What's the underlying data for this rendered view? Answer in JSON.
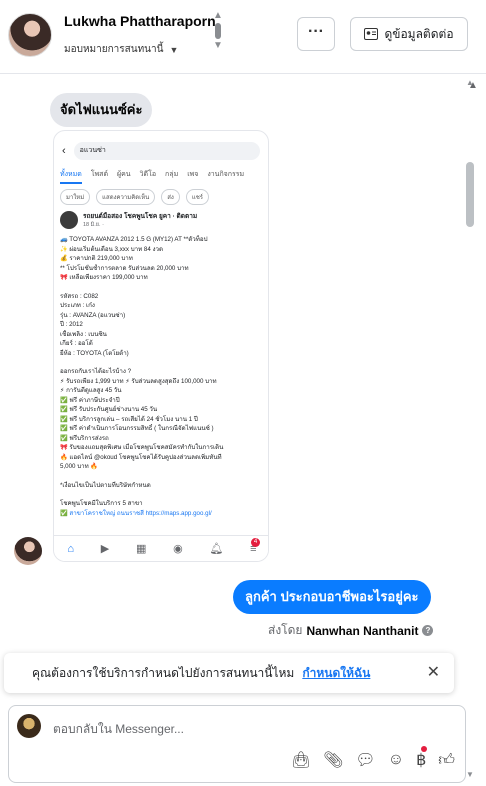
{
  "header": {
    "contact_name": "Lukwha Phattharaporn",
    "assign_label": "มอบหมายการสนทนานี้",
    "more_label": "···",
    "contact_info_label": "ดูข้อมูลติดต่อ"
  },
  "messages": {
    "incoming_text": "จัดไฟแนนซ์ค่ะ",
    "outgoing_text": "ลูกค้า ประกอบอาชีพอะไรอยู่คะ",
    "sent_by_prefix": "ส่งโดย",
    "sent_by_name": "Nanwhan Nanthanit"
  },
  "shared_screenshot": {
    "search_text": "อแวนซ่า",
    "tabs": [
      "ทั้งหมด",
      "โพสต์",
      "ผู้คน",
      "วิดีโอ",
      "กลุ่ม",
      "เพจ",
      "งานกิจกรรม"
    ],
    "chips": [
      "มาใหม่",
      "แสดงความคิดเห็น",
      "ส่ง",
      "แชร์"
    ],
    "post_author": "รถยนต์มือสอง โชคพูนโชค ยูคา · ติดตาม",
    "post_date": "18 มิ.ย. · ",
    "body_lines": [
      "🚙 TOYOTA AVANZA 2012 1.5 G (MY12) AT **ตัวท็อป",
      "✨ ผ่อนเริ่มต้นเดือน 3,xxx บาท 84 งวด",
      "💰 ราคาปกติ 219,000 บาท",
      "** โปรโมชั่นช้ำการตลาด รับส่วนลด 20,000 บาท",
      "🎀 เหลือเพียงราคา 199,000 บาท",
      "",
      "รหัสรถ : C082",
      "ประเภท : เก๋ง",
      "รุ่น : AVANZA (อแวนซ่า)",
      "ปี : 2012",
      "เชื้อเพลิง : เบนซิน",
      "เกียร์ : ออโต้",
      "ยี่ห้อ : TOYOTA (โตโยต้า)",
      "",
      "ออกรถกับเราได้อะไรบ้าง ?",
      "⚡ รับรถเพียง 1,999 บาท ⚡ รับส่วนลดสูงสุดถึง 100,000 บาท",
      "⚡ การันตีดูแลสูง 45 วัน",
      "✅ ฟรี ค่าภาษีประจำปี",
      "✅ ฟรี รับประกันศูนย์ช่างนาน 45 วัน",
      "✅ ฟรี บริการลูกเล่น – รถเสียได้ 24 ชั่วโมง นาน 1 ปี",
      "✅ ฟรี ค่าดำเนินการโอนกรรมสิทธิ์ ( ในกรณีจัดไฟแนนซ์ )",
      "✅ ฟรีบริการส่งรถ",
      "🎀 รับของแถมสุดพิเศษ เมื่อโชคพูนโชคสมัครทำกับในการเดิน",
      "🔥 แอดไลน์ @okoud โชคพูนโชคได้รับคูปองส่วนลดเพิ่มทันที",
      "5,000 บาท 🔥",
      "",
      "*เงื่อนไขเป็นไปตามที่บริษัทกำหนด",
      "",
      "โชคพูนโชคมีในบริการ 5 สาขา",
      "✅ สาขาโคราชใหญ่ ถนนราชสี https://maps.app.goo.gl/"
    ],
    "nav_badge": "4"
  },
  "banner": {
    "text": "คุณต้องการใช้บริการกำหนดไปยังการสนทนานี้ไหม",
    "cta": "กำหนดให้ฉัน"
  },
  "composer": {
    "placeholder": "ตอบกลับใน Messenger..."
  },
  "colors": {
    "accent": "#0a7cff",
    "link": "#1877f2",
    "incoming_bubble": "#e4e6eb"
  }
}
